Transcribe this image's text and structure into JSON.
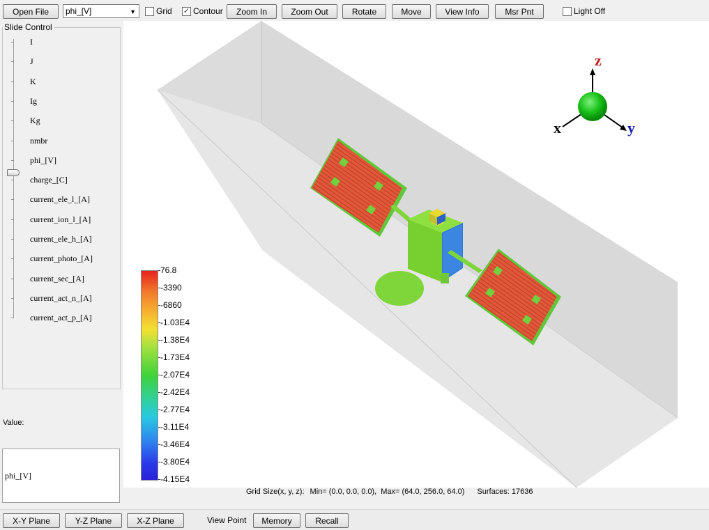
{
  "toolbar": {
    "open_file": "Open File",
    "variable_select": "phi_[V]",
    "grid_label": "Grid",
    "grid_checked": false,
    "contour_label": "Contour",
    "contour_checked": true,
    "zoom_in": "Zoom In",
    "zoom_out": "Zoom Out",
    "rotate": "Rotate",
    "move": "Move",
    "view_info": "View Info",
    "msr_pnt": "Msr Pnt",
    "light_off_label": "Light Off",
    "light_off_checked": false
  },
  "slide_control": {
    "title": "Slide Control",
    "items": [
      "I",
      "J",
      "K",
      "Ig",
      "Kg",
      "nmbr",
      "phi_[V]",
      "charge_[C]",
      "current_ele_l_[A]",
      "current_ion_l_[A]",
      "current_ele_h_[A]",
      "current_photo_[A]",
      "current_sec_[A]",
      "current_act_n_[A]",
      "current_act_p_[A]"
    ],
    "selected": "phi_[V]",
    "value_label": "Value:",
    "value_text": "phi_[V]"
  },
  "axes_gizmo": {
    "z": "z",
    "x": "x",
    "y": "y"
  },
  "colorbar": {
    "labels": [
      "76.8",
      "-3390",
      "-6860",
      "-1.03E4",
      "-1.38E4",
      "-1.73E4",
      "-2.07E4",
      "-2.42E4",
      "-2.77E4",
      "-3.11E4",
      "-3.46E4",
      "-3.80E4",
      "-4.15E4"
    ]
  },
  "status": {
    "grid_size": "Grid Size(x, y, z):",
    "min": "Min= (0.0, 0.0, 0.0),",
    "max": "Max= (64.0, 256.0, 64.0)",
    "surfaces": "Surfaces: 17636"
  },
  "bottom": {
    "xy_plane": "X-Y Plane",
    "yz_plane": "Y-Z Plane",
    "xz_plane": "X-Z Plane",
    "view_point": "View Point",
    "memory": "Memory",
    "recall": "Recall"
  },
  "colors": {
    "panel_red": "#e0553a",
    "panel_edge": "#7ed63a",
    "body_green": "#7ed63a",
    "body_blue": "#2f6fd8",
    "sphere_green": "#18c018"
  }
}
